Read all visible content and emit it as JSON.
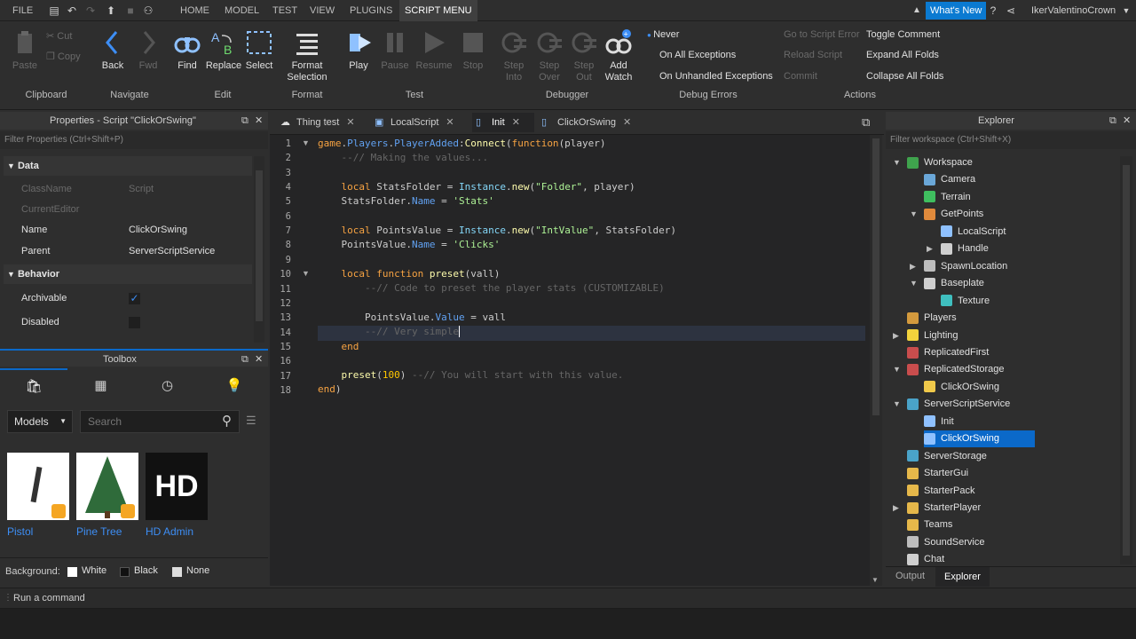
{
  "menubar": {
    "file": "FILE",
    "tabs": [
      "HOME",
      "MODEL",
      "TEST",
      "VIEW",
      "PLUGINS",
      "SCRIPT MENU"
    ],
    "whats_new": "What's New",
    "username": "IkerValentinoCrown"
  },
  "ribbon": {
    "clipboard": {
      "paste": "Paste",
      "cut": "Cut",
      "copy": "Copy",
      "label": "Clipboard"
    },
    "navigate": {
      "back": "Back",
      "fwd": "Fwd",
      "label": "Navigate"
    },
    "edit": {
      "find": "Find",
      "replace": "Replace",
      "select": "Select",
      "label": "Edit"
    },
    "format": {
      "format_selection": "Format Selection",
      "label": "Format"
    },
    "test": {
      "play": "Play",
      "pause": "Pause",
      "resume": "Resume",
      "stop": "Stop",
      "label": "Test"
    },
    "debugger": {
      "step_into": "Step Into",
      "step_over": "Step Over",
      "step_out": "Step Out",
      "add_watch": "Add Watch",
      "label": "Debugger"
    },
    "debug_errors": {
      "never": "Never",
      "all": "On All Exceptions",
      "unhandled": "On Unhandled Exceptions",
      "label": "Debug Errors"
    },
    "actions": {
      "go_to_error": "Go to Script Error",
      "reload": "Reload Script",
      "commit": "Commit",
      "toggle_comment": "Toggle Comment",
      "expand": "Expand All Folds",
      "collapse": "Collapse All Folds",
      "label": "Actions"
    }
  },
  "properties": {
    "title": "Properties - Script \"ClickOrSwing\"",
    "filter": "Filter Properties (Ctrl+Shift+P)",
    "data_section": "Data",
    "rows": [
      {
        "k": "ClassName",
        "v": "Script"
      },
      {
        "k": "CurrentEditor",
        "v": ""
      },
      {
        "k": "Name",
        "v": "ClickOrSwing"
      },
      {
        "k": "Parent",
        "v": "ServerScriptService"
      }
    ],
    "behavior_section": "Behavior",
    "archivable": "Archivable",
    "disabled": "Disabled",
    "check_mark": "✓"
  },
  "toolbox": {
    "title": "Toolbox",
    "category": "Models",
    "search_placeholder": "Search",
    "items": [
      "Pistol",
      "Pine Tree",
      "HD Admin"
    ],
    "hd_text": "HD",
    "background_label": "Background:",
    "bg_options": [
      "White",
      "Black",
      "None"
    ]
  },
  "tabs": [
    "Thing test",
    "LocalScript",
    "Init",
    "ClickOrSwing"
  ],
  "editor": {
    "line_numbers": [
      "1",
      "2",
      "3",
      "4",
      "5",
      "6",
      "7",
      "8",
      "9",
      "10",
      "11",
      "12",
      "13",
      "14",
      "15",
      "16",
      "17",
      "18"
    ]
  },
  "explorer": {
    "title": "Explorer",
    "filter": "Filter workspace (Ctrl+Shift+X)",
    "items": [
      "Workspace",
      "Camera",
      "Terrain",
      "GetPoints",
      "LocalScript",
      "Handle",
      "SpawnLocation",
      "Baseplate",
      "Texture",
      "Players",
      "Lighting",
      "ReplicatedFirst",
      "ReplicatedStorage",
      "ClickOrSwing",
      "ServerScriptService",
      "Init",
      "ClickOrSwing",
      "ServerStorage",
      "StarterGui",
      "StarterPack",
      "StarterPlayer",
      "Teams",
      "SoundService",
      "Chat"
    ],
    "bottom_tabs": [
      "Output",
      "Explorer"
    ]
  },
  "command_bar": {
    "placeholder": "Run a command"
  },
  "colors": {
    "accent": "#0b69c9",
    "selection": "#0b69c9",
    "whats_new_bg": "#0b7ad1"
  }
}
